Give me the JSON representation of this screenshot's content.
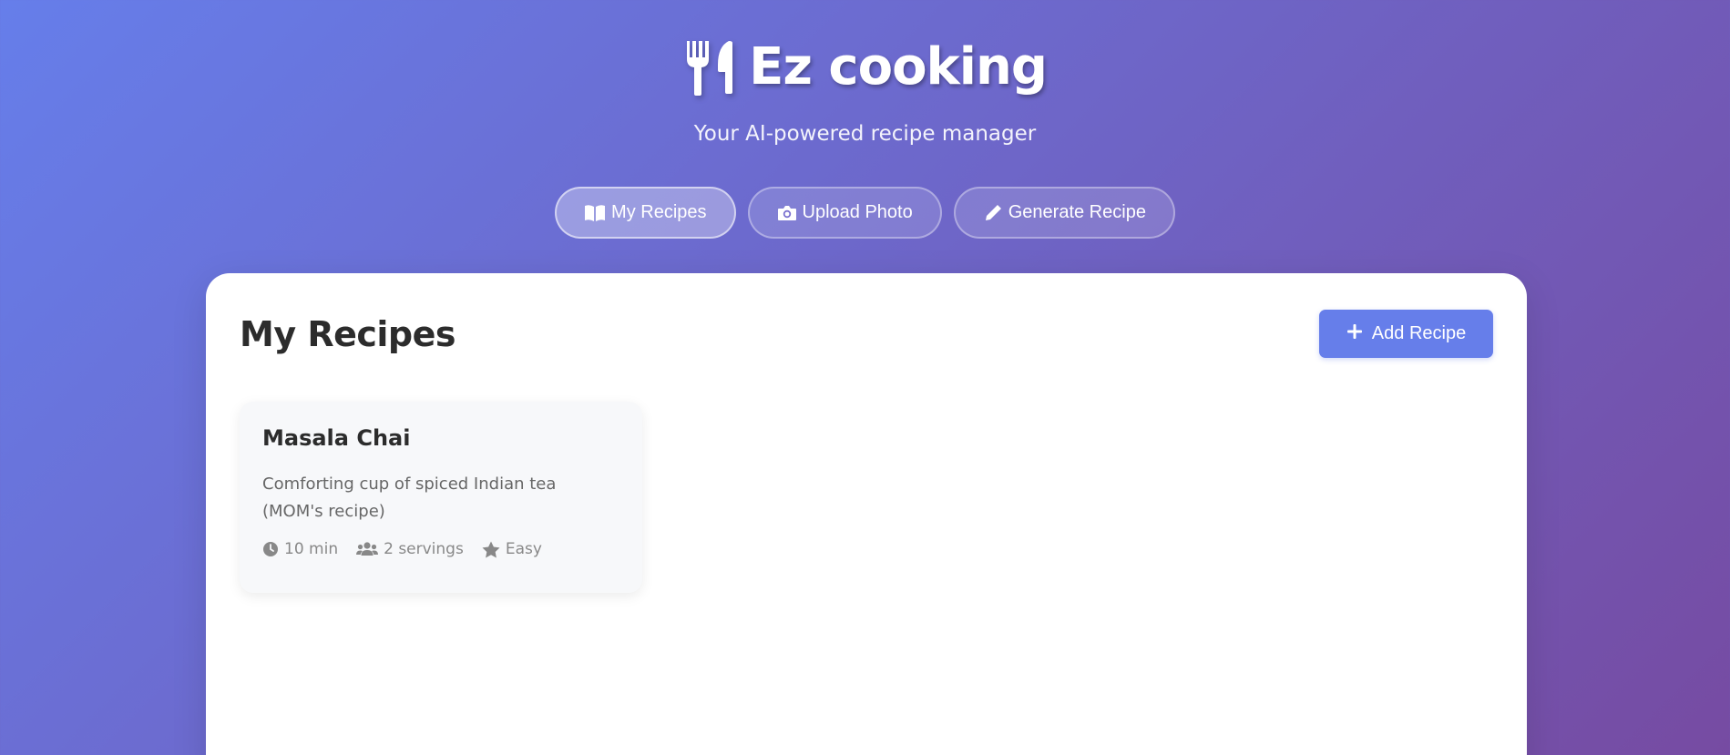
{
  "app": {
    "title": "Ez cooking",
    "tagline": "Your AI-powered recipe manager",
    "logo_icon": "utensils-icon"
  },
  "nav": {
    "items": [
      {
        "label": "My Recipes",
        "icon": "book-open-icon",
        "active": true
      },
      {
        "label": "Upload Photo",
        "icon": "camera-icon",
        "active": false
      },
      {
        "label": "Generate Recipe",
        "icon": "pen-icon",
        "active": false
      }
    ]
  },
  "main": {
    "title": "My Recipes",
    "add_button": {
      "label": "Add Recipe",
      "icon": "plus-icon"
    },
    "recipes": [
      {
        "name": "Masala Chai",
        "description": "Comforting cup of spiced Indian tea (MOM's recipe)",
        "time": "10 min",
        "servings": "2 servings",
        "difficulty": "Easy"
      }
    ]
  },
  "colors": {
    "gradient_start": "#667eea",
    "gradient_end": "#764ba2",
    "accent": "#667eea"
  }
}
